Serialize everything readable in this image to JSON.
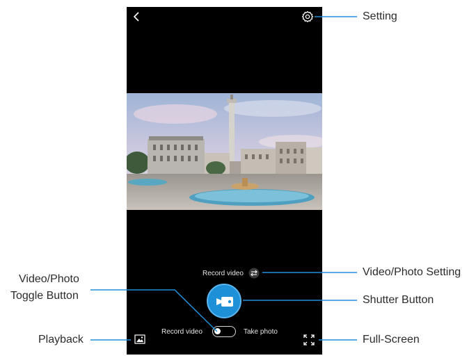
{
  "camera": {
    "record_mode_label": "Record video",
    "toggle_left_label": "Record video",
    "toggle_right_label": "Take photo",
    "accent_color": "#1e90d8"
  },
  "callouts": {
    "setting": "Setting",
    "video_photo_setting": "Video/Photo Setting",
    "shutter_button": "Shutter Button",
    "toggle_line1": "Video/Photo",
    "toggle_line2": "Toggle Button",
    "playback": "Playback",
    "full_screen": "Full-Screen",
    "line_color": "#1e90d8"
  },
  "icons": {
    "back": "chevron-left-icon",
    "setting": "gear-icon",
    "swap": "swap-arrows-icon",
    "shutter": "video-camera-icon",
    "playback": "image-icon",
    "fullscreen": "expand-icon"
  }
}
